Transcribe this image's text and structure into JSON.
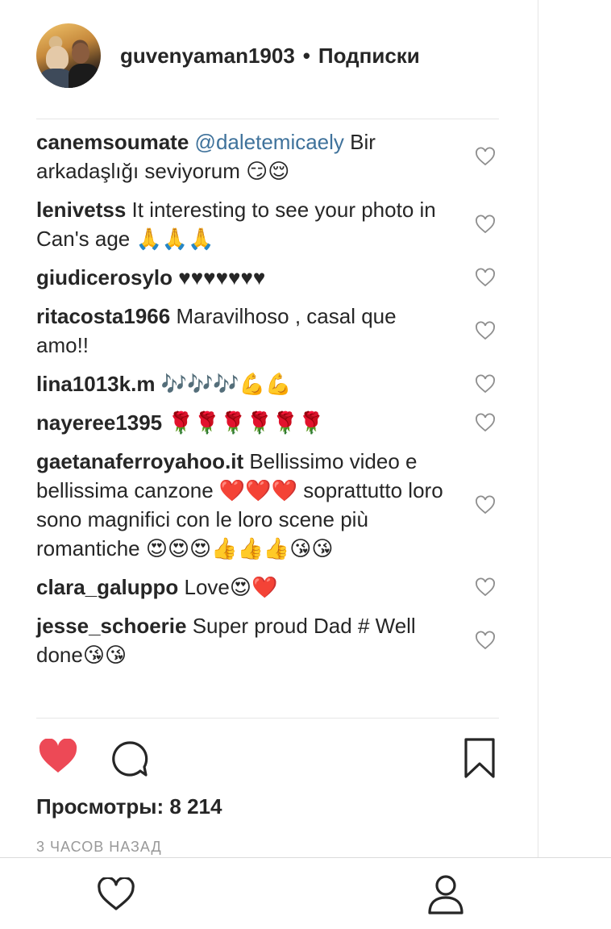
{
  "post": {
    "username": "guvenyaman1903",
    "separator": "•",
    "follow_label": "Подписки"
  },
  "comments": [
    {
      "user": "canemsoumate",
      "mention": "@daletemicaely",
      "text": " Bir arkadaşlığı seviyorum 😏😌"
    },
    {
      "user": "lenivetss",
      "mention": "",
      "text": " It interesting to see your photo in Can's age 🙏🙏🙏"
    },
    {
      "user": "giudicerosylo",
      "mention": "",
      "text": " ♥♥♥♥♥♥♥"
    },
    {
      "user": "ritacosta1966",
      "mention": "",
      "text": " Maravilhoso , casal que amo!!"
    },
    {
      "user": "lina1013k.m",
      "mention": "",
      "text": " 🎶🎶🎶💪💪"
    },
    {
      "user": "nayeree1395",
      "mention": "",
      "text": " 🌹🌹🌹🌹🌹🌹"
    },
    {
      "user": "gaetanaferroyahoo.it",
      "mention": "",
      "text": " Bellissimo video e bellissima canzone ❤️❤️❤️ soprattutto loro sono magnifici con le loro scene più romantiche 😍😍😍👍👍👍😘😘"
    },
    {
      "user": "clara_galuppo",
      "mention": "",
      "text": " Love😍❤️"
    },
    {
      "user": "jesse_schoerie",
      "mention": "",
      "text": " Super proud Dad # Well done😘😘"
    }
  ],
  "actions": {
    "like_icon": "heart-filled-icon",
    "comment_icon": "comment-bubble-icon",
    "save_icon": "bookmark-icon",
    "liked": true,
    "like_color": "#ed4956"
  },
  "stats": {
    "views_label": "Просмотры: 8 214",
    "time_ago": "3 ЧАСОВ НАЗАД"
  },
  "bottom_nav": {
    "items": [
      "heart-outline-icon",
      "profile-icon"
    ]
  }
}
